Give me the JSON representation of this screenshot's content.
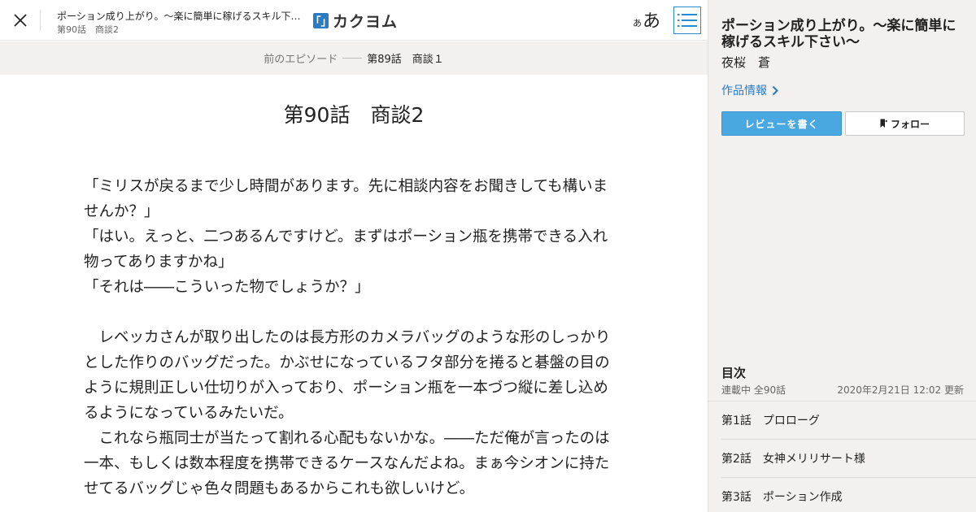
{
  "header": {
    "work_title": "ポーション成り上がり。～楽に簡単に稼げるスキル下さい～",
    "episode": "第90話　商談2",
    "logo_mark": "「」",
    "logo_text": "カクヨム",
    "font_small": "あ",
    "font_big": "あ"
  },
  "nav": {
    "prev_label": "前のエピソード",
    "prev_title": "第89話　商談１"
  },
  "episode": {
    "title": "第90話　商談2",
    "paragraphs": [
      "「ミリスが戻るまで少し時間があります。先に相談内容をお聞きしても構いませんか？」",
      "「はい。えっと、二つあるんですけど。まずはポーション瓶を携帯できる入れ物ってありますかね」",
      "「それは――こういった物でしょうか？」",
      "",
      "　レベッカさんが取り出したのは長方形のカメラバッグのような形のしっかりとした作りのバッグだった。かぶせになっているフタ部分を捲ると碁盤の目のように規則正しい仕切りが入っており、ポーション瓶を一本づつ縦に差し込めるようになっているみたいだ。",
      "　これなら瓶同士が当たって割れる心配もないかな。――ただ俺が言ったのは一本、もしくは数本程度を携帯できるケースなんだよね。まぁ今シオンに持たせてるバッグじゃ色々問題もあるからこれも欲しいけど。"
    ]
  },
  "sidebar": {
    "title": "ポーション成り上がり。～楽に簡単に稼げるスキル下さい～",
    "author": "夜桜　蒼",
    "info_link": "作品情報",
    "review_button": "レビューを書く",
    "follow_button": "フォロー",
    "toc_heading": "目次",
    "toc_status": "連載中 全90話",
    "toc_updated": "2020年2月21日 12:02 更新",
    "toc_items": [
      {
        "label": "第1話　プロローグ"
      },
      {
        "label": "第2話　女神メリリサート様"
      },
      {
        "label": "第3話　ポーション作成"
      }
    ]
  },
  "colors": {
    "accent": "#2a7bc1",
    "review_button": "#4aa8e0",
    "sidebar_bg": "#f2f1f0"
  }
}
